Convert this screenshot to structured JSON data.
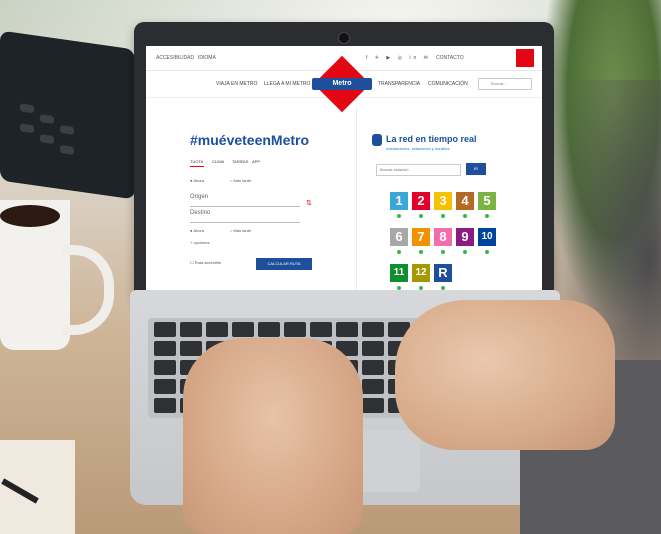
{
  "site": {
    "top_links": [
      "ACCESIBILIDAD",
      "IDIOMA"
    ],
    "contact_label": "CONTACTO",
    "nav": [
      "VIAJA EN METRO",
      "LLEGA A MI METRO",
      "TRANSPARENCIA",
      "COMUNICACIÓN"
    ],
    "logo_text": "Metro",
    "search_placeholder": "Buscar..."
  },
  "planner": {
    "hashtag": "#muéveteenMetro",
    "tabs": [
      "TUOTA",
      "CLIMA",
      "TARIFAS",
      "APP"
    ],
    "radio_1": "Ahora",
    "radio_2": "Más tarde",
    "origin_placeholder": "Origen",
    "destination_placeholder": "Destino",
    "options_link": "+ opciones",
    "accessible_label": "Ruta accesible",
    "search_button": "CALCULAR RUTA"
  },
  "realtime": {
    "title": "La red en tiempo real",
    "subtitle": "Instalaciones, estaciones y horarios",
    "station_placeholder": "Buscar estación",
    "go_button": "IR"
  },
  "lines": [
    {
      "label": "1",
      "color": "#3aa7d8"
    },
    {
      "label": "2",
      "color": "#e4002b"
    },
    {
      "label": "3",
      "color": "#f6c200"
    },
    {
      "label": "4",
      "color": "#b46a22"
    },
    {
      "label": "5",
      "color": "#7cb342"
    },
    {
      "label": "6",
      "color": "#a8a8a8"
    },
    {
      "label": "7",
      "color": "#f39200"
    },
    {
      "label": "8",
      "color": "#f06eaa"
    },
    {
      "label": "9",
      "color": "#8b1d82"
    },
    {
      "label": "10",
      "color": "#00449e"
    },
    {
      "label": "11",
      "color": "#0d8f2f"
    },
    {
      "label": "12",
      "color": "#a49a00"
    },
    {
      "label": "R",
      "color": "#1d4f9c"
    }
  ]
}
